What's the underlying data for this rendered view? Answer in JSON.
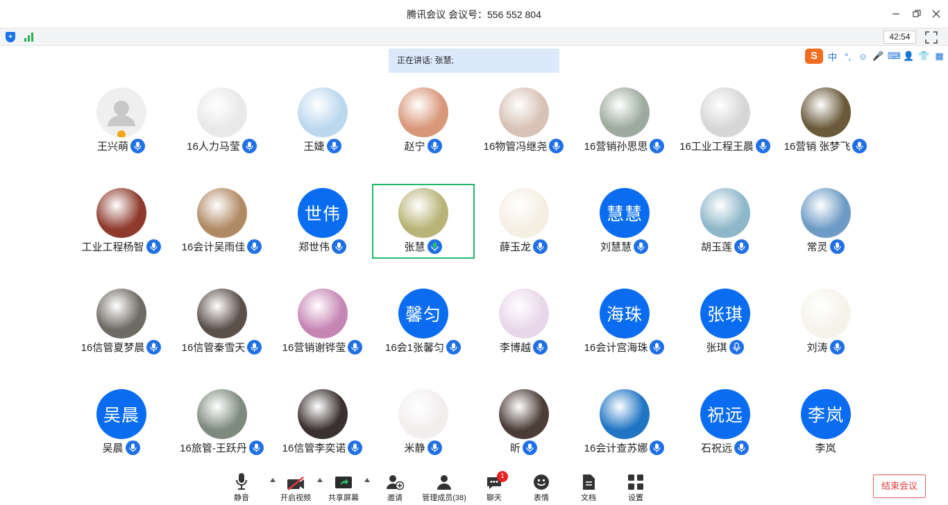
{
  "window": {
    "title": "腾讯会议 会议号：556 552 804"
  },
  "infobar": {
    "timer": "42:54"
  },
  "speaking": {
    "text": "正在讲话: 张慧;"
  },
  "ime": {
    "logo": "S",
    "items": [
      "中",
      "°,",
      "☺",
      "🎤",
      "⌨",
      "👤",
      "👕",
      "▦"
    ]
  },
  "participants": [
    {
      "name": "王兴萌",
      "type": "default"
    },
    {
      "name": "16人力马莹",
      "type": "photo",
      "color": "#e9e9e9"
    },
    {
      "name": "王婕",
      "type": "photo",
      "color": "#bcd8ef"
    },
    {
      "name": "赵宁",
      "type": "photo",
      "color": "#d9977a"
    },
    {
      "name": "16物管冯继尧",
      "type": "photo",
      "color": "#d8c2b6"
    },
    {
      "name": "16营销孙思思",
      "type": "photo",
      "color": "#9cab9d"
    },
    {
      "name": "16工业工程王晨",
      "type": "photo",
      "color": "#d6d6d6"
    },
    {
      "name": "16营销 张梦飞",
      "type": "photo",
      "color": "#6a5a3a"
    },
    {
      "name": "工业工程杨智",
      "type": "photo",
      "color": "#8e3a2c"
    },
    {
      "name": "16会计吴雨佳",
      "type": "photo",
      "color": "#b08a64"
    },
    {
      "name": "郑世伟",
      "type": "text",
      "initials": "世伟"
    },
    {
      "name": "张慧",
      "type": "photo",
      "color": "#b8b478",
      "active": true
    },
    {
      "name": "薛玉龙",
      "type": "photo",
      "color": "#f4efe3"
    },
    {
      "name": "刘慧慧",
      "type": "text",
      "initials": "慧慧"
    },
    {
      "name": "胡玉莲",
      "type": "photo",
      "color": "#8eb7c9"
    },
    {
      "name": "常灵",
      "type": "photo",
      "color": "#6d9bc5"
    },
    {
      "name": "16信管夏梦晨",
      "type": "photo",
      "color": "#6e6a64"
    },
    {
      "name": "16信管秦雪天",
      "type": "photo",
      "color": "#5b504a"
    },
    {
      "name": "16营销谢铧莹",
      "type": "photo",
      "color": "#c686b4"
    },
    {
      "name": "16会1张馨匀",
      "type": "text",
      "initials": "馨匀"
    },
    {
      "name": "李博越",
      "type": "photo",
      "color": "#e8d7ea"
    },
    {
      "name": "16会计宫海珠",
      "type": "text",
      "initials": "海珠"
    },
    {
      "name": "张琪",
      "type": "text",
      "initials": "张琪",
      "mic_style": "outline"
    },
    {
      "name": "刘涛",
      "type": "photo",
      "color": "#f5f3ea"
    },
    {
      "name": "吴晨",
      "type": "text",
      "initials": "吴晨"
    },
    {
      "name": "16旅管-王跃丹",
      "type": "photo",
      "color": "#7d8a7d"
    },
    {
      "name": "16信管李奕诺",
      "type": "photo",
      "color": "#3b3030"
    },
    {
      "name": "米静",
      "type": "photo",
      "color": "#f2eeee"
    },
    {
      "name": "昕",
      "type": "photo",
      "color": "#4b3c36"
    },
    {
      "name": "16会计查苏娜",
      "type": "photo",
      "color": "#1f74c4"
    },
    {
      "name": "石祝远",
      "type": "text",
      "initials": "祝远"
    },
    {
      "name": "李岚",
      "type": "text",
      "initials": "李岚",
      "no_mic": true
    }
  ],
  "toolbar": {
    "mute": "静音",
    "video": "开启视频",
    "share": "共享屏幕",
    "invite": "邀请",
    "members": "管理成员(38)",
    "chat": "聊天",
    "chat_badge": "1",
    "reaction": "表情",
    "docs": "文档",
    "settings": "设置",
    "end": "结束会议"
  }
}
